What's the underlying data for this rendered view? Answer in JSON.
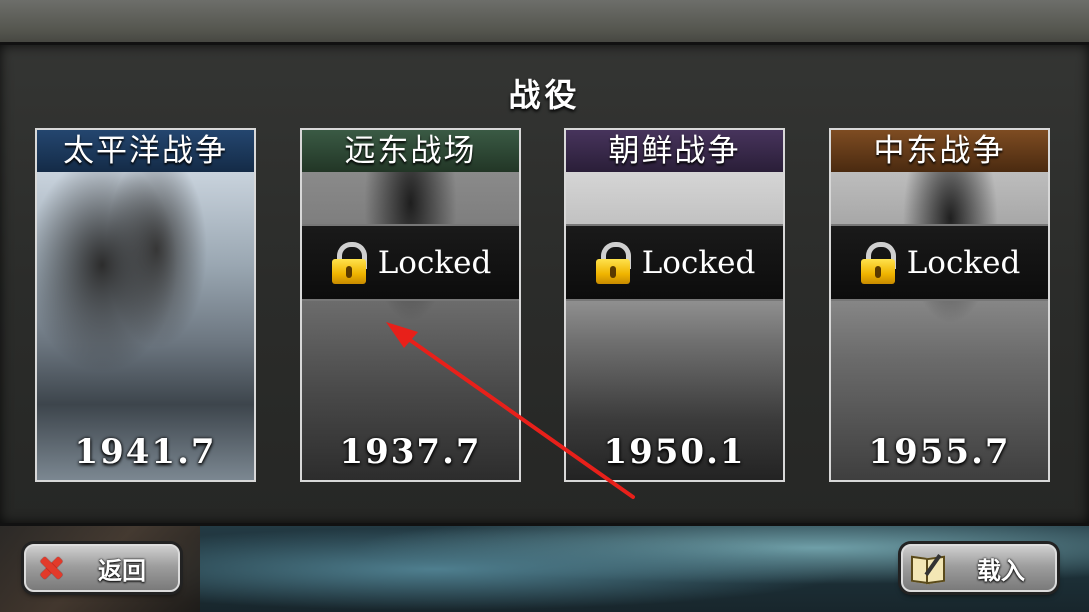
{
  "title": "战役",
  "campaigns": [
    {
      "name": "太平洋战争",
      "year": "1941.7",
      "locked": false,
      "header_color": "#1e3a5f"
    },
    {
      "name": "远东战场",
      "year": "1937.7",
      "locked": true,
      "locked_label": "Locked",
      "header_color": "#2e4a36"
    },
    {
      "name": "朝鲜战争",
      "year": "1950.1",
      "locked": true,
      "locked_label": "Locked",
      "header_color": "#3a2a4a"
    },
    {
      "name": "中东战争",
      "year": "1955.7",
      "locked": true,
      "locked_label": "Locked",
      "header_color": "#6a3e1a"
    }
  ],
  "buttons": {
    "back_label": "返回",
    "load_label": "载入"
  },
  "annotation": {
    "color": "#e8201a"
  }
}
